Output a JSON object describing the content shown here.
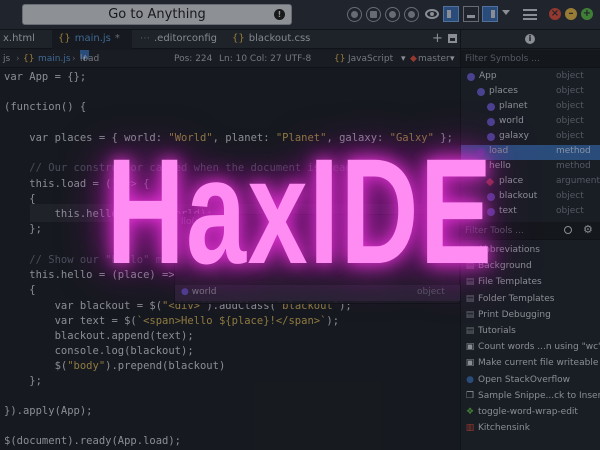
{
  "toolbar": {
    "goto_label": "Go to Anything",
    "accent": "#3c6fb4"
  },
  "tabs": [
    {
      "label": "x.html",
      "modified": false
    },
    {
      "label": "main.js",
      "modified": true
    },
    {
      "label": ".editorconfig",
      "modified": false
    },
    {
      "label": "blackout.css",
      "modified": false
    }
  ],
  "statusbar": {
    "crumb_prefix": "js",
    "file": "main.js",
    "symbol": "load",
    "position": "Pos: 224",
    "line_col": "Ln: 10 Col: 27",
    "encoding": "UTF-8",
    "language": "JavaScript",
    "branch": "master"
  },
  "code": {
    "l1": "var App = {};",
    "l2": "(function() {",
    "l3a": "    var places = { world: ",
    "l3b": "\"World\"",
    "l3c": ", planet: ",
    "l3d": "\"Planet\"",
    "l3e": ", galaxy: ",
    "l3f": "\"Galxy\"",
    "l3g": " };",
    "l4": "    // Our constructor called when the document is ready",
    "l5": "    this.load = () => {",
    "l6": "    {",
    "l7": "        this.hello(places.world);",
    "l8": "    };",
    "l9": "    // Show our \"hello\" message",
    "l10": "    this.hello = (place) =>",
    "l11": "    {",
    "l12a": "        var blackout = $(",
    "l12b": "\"<div>\"",
    "l12c": ").addClass(",
    "l12d": "\"blackout\"",
    "l12e": ");",
    "l13a": "        var text = $(",
    "l13b": "`<span>Hello ${place}!</span>`",
    "l13c": ");",
    "l14": "        blackout.append(text);",
    "l15": "        console.log(blackout);",
    "l16a": "        $(",
    "l16b": "\"body\"",
    "l16c": ").prepend(blackout)",
    "l17": "    };",
    "l18": "}).apply(App);",
    "l19": "$(document).ready(App.load);"
  },
  "autocomplete": {
    "partial": "llo(p",
    "selected_name": "world",
    "selected_type": "object"
  },
  "symbols": {
    "filter_placeholder": "Filter Symbols ...",
    "items": [
      {
        "name": "App",
        "type": "object"
      },
      {
        "name": "places",
        "type": "object"
      },
      {
        "name": "planet",
        "type": "object"
      },
      {
        "name": "world",
        "type": "object"
      },
      {
        "name": "galaxy",
        "type": "object"
      },
      {
        "name": "load",
        "type": "method"
      },
      {
        "name": "hello",
        "type": "method"
      },
      {
        "name": "place",
        "type": "argument"
      },
      {
        "name": "blackout",
        "type": "object"
      },
      {
        "name": "text",
        "type": "object"
      }
    ]
  },
  "tools": {
    "filter_placeholder": "Filter Tools ...",
    "items": [
      {
        "label": "Abbreviations",
        "icon": "folder-icon"
      },
      {
        "label": "Background",
        "icon": "folder-icon"
      },
      {
        "label": "File Templates",
        "icon": "folder-icon"
      },
      {
        "label": "Folder Templates",
        "icon": "folder-icon"
      },
      {
        "label": "Print Debugging",
        "icon": "folder-icon"
      },
      {
        "label": "Tutorials",
        "icon": "folder-icon"
      },
      {
        "label": "Count words ...n using \"wc\"",
        "icon": "command-icon"
      },
      {
        "label": "Make current file writeable",
        "icon": "command-icon"
      },
      {
        "label": "Open StackOverflow",
        "icon": "globe-icon"
      },
      {
        "label": "Sample Snippe...ck to Insert",
        "icon": "snippet-icon"
      },
      {
        "label": "toggle-word-wrap-edit",
        "icon": "macro-icon"
      },
      {
        "label": "Kitchensink",
        "icon": "kit-icon"
      }
    ]
  },
  "overlay": {
    "title": "HaxIDE",
    "color": "#ff8cf3"
  }
}
